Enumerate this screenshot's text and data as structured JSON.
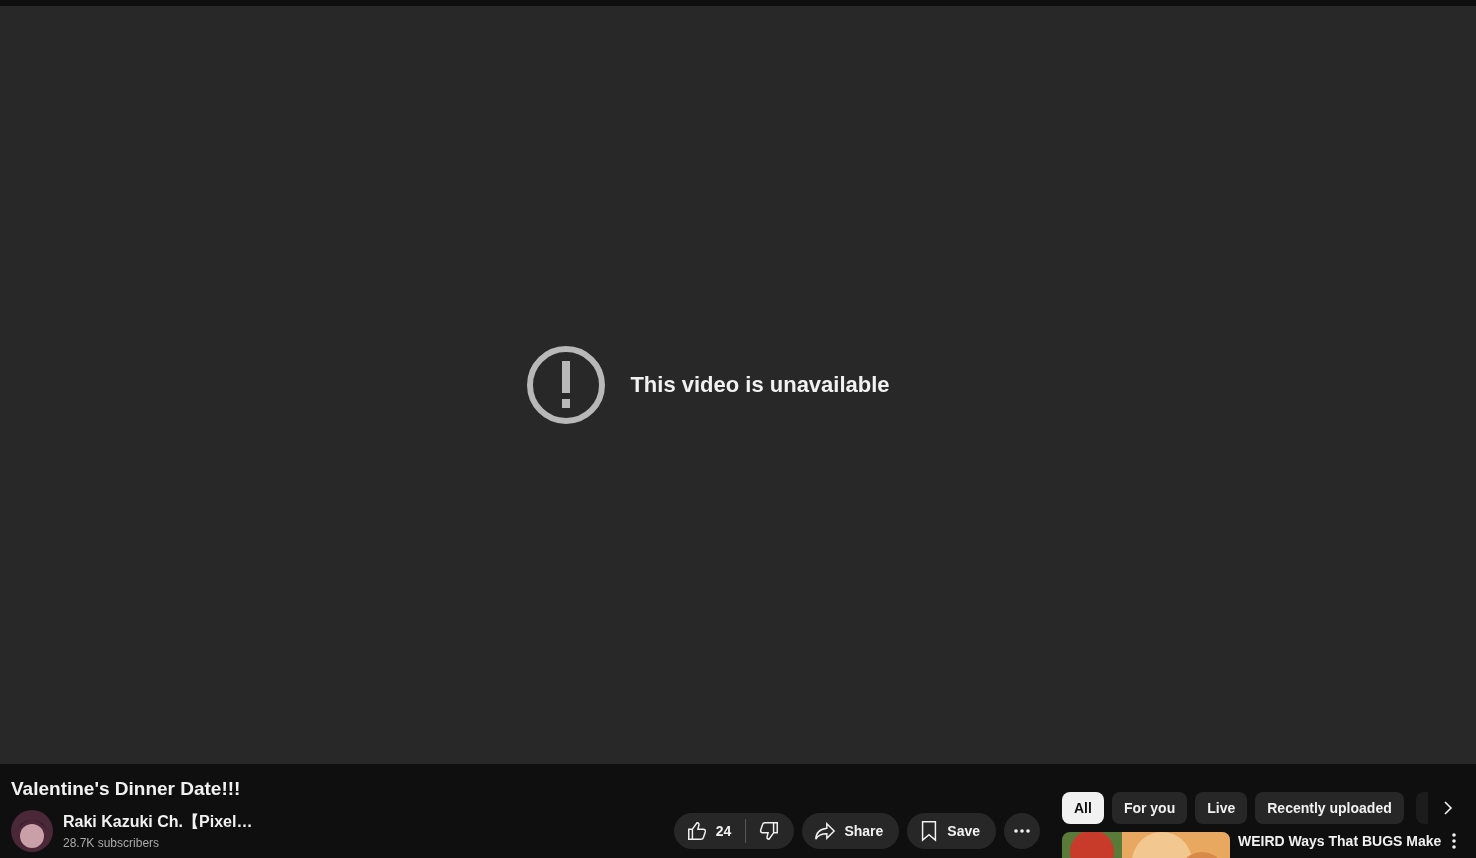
{
  "player": {
    "message": "This video is unavailable"
  },
  "video": {
    "title": "Valentine's Dinner Date!!!",
    "channel": "Raki Kazuki Ch.【Pixel…",
    "subscribers": "28.7K subscribers"
  },
  "actions": {
    "likes": "24",
    "share": "Share",
    "save": "Save"
  },
  "chips": [
    {
      "label": "All",
      "selected": true
    },
    {
      "label": "For you",
      "selected": false
    },
    {
      "label": "Live",
      "selected": false
    },
    {
      "label": "Recently uploaded",
      "selected": false
    }
  ],
  "recommendations": [
    {
      "title": "WEIRD Ways That BUGS Make",
      "kind": "picture"
    }
  ]
}
